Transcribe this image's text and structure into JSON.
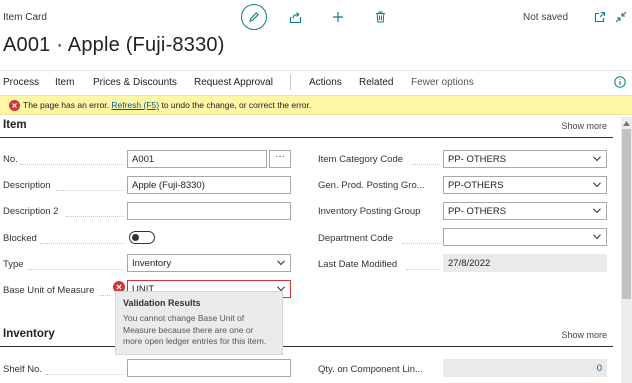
{
  "header": {
    "page_type": "Item Card",
    "title": "A001 · Apple (Fuji-8330)",
    "status": "Not saved",
    "icons": [
      "pencil-icon",
      "share-icon",
      "plus-icon",
      "trash-icon",
      "open-new-window-icon",
      "collapse-icon"
    ]
  },
  "actions": {
    "items": [
      "Process",
      "Item",
      "Prices & Discounts",
      "Request Approval",
      "Actions",
      "Related",
      "Fewer options"
    ]
  },
  "error_bar": {
    "before": "The page has an error. ",
    "link": "Refresh (F5)",
    "after": " to undo the change, or correct the error."
  },
  "item_section": {
    "title": "Item",
    "show_more": "Show more",
    "fields": {
      "no": {
        "label": "No.",
        "value": "A001"
      },
      "description": {
        "label": "Description",
        "value": "Apple (Fuji-8330)"
      },
      "description2": {
        "label": "Description 2",
        "value": ""
      },
      "blocked": {
        "label": "Blocked",
        "value": false
      },
      "type": {
        "label": "Type",
        "value": "Inventory"
      },
      "base_uom": {
        "label": "Base Unit of Measure",
        "value": "UNIT"
      },
      "item_category": {
        "label": "Item Category Code",
        "value": "PP- OTHERS"
      },
      "gen_prod": {
        "label": "Gen. Prod. Posting Gro...",
        "value": "PP-OTHERS"
      },
      "inv_posting": {
        "label": "Inventory Posting Group",
        "value": "PP- OTHERS"
      },
      "department": {
        "label": "Department Code",
        "value": ""
      },
      "last_modified": {
        "label": "Last Date Modified",
        "value": "27/8/2022"
      }
    }
  },
  "validation": {
    "title": "Validation Results",
    "message": "You cannot change Base Unit of Measure because there are one or more open ledger entries for this item."
  },
  "inventory_section": {
    "title": "Inventory",
    "show_more": "Show more",
    "fields": {
      "shelf": {
        "label": "Shelf No.",
        "value": ""
      },
      "qty_component": {
        "label": "Qty. on Component Lin...",
        "value": "0"
      }
    }
  },
  "colors": {
    "accent": "#0e7c86",
    "error": "#d13438",
    "error_bar_bg": "#fdf6a5",
    "link": "#005a9e"
  }
}
